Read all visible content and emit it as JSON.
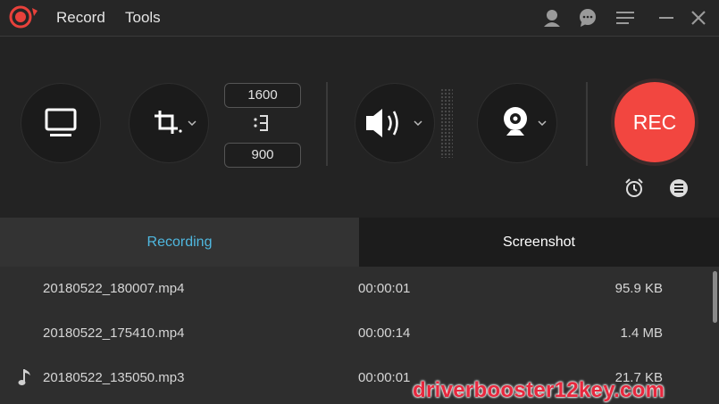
{
  "menu": {
    "record": "Record",
    "tools": "Tools"
  },
  "titlebar_icons": [
    "user-icon",
    "chat-icon",
    "menu-icon",
    "minimize-icon",
    "close-icon"
  ],
  "region": {
    "width": "1600",
    "height": "900"
  },
  "rec_label": "REC",
  "tabs": {
    "recording": "Recording",
    "screenshot": "Screenshot"
  },
  "files": [
    {
      "name": "20180522_180007.mp4",
      "duration": "00:00:01",
      "size": "95.9 KB",
      "icon": ""
    },
    {
      "name": "20180522_175410.mp4",
      "duration": "00:00:14",
      "size": "1.4 MB",
      "icon": ""
    },
    {
      "name": "20180522_135050.mp3",
      "duration": "00:00:01",
      "size": "21.7 KB",
      "icon": "music-note-icon"
    }
  ],
  "watermark": "driverbooster12key.com",
  "colors": {
    "rec": "#f24640",
    "active_tab_text": "#4fb8e0",
    "logo": "#e8413b"
  }
}
